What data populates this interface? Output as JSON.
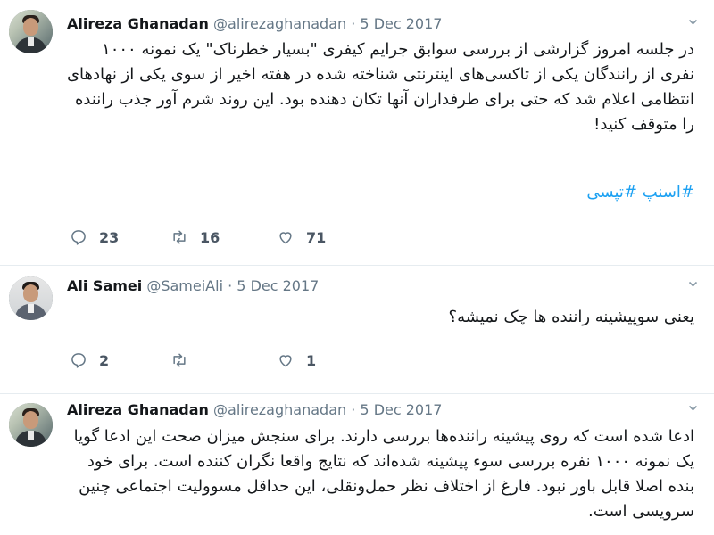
{
  "tweets": [
    {
      "name": "Alireza Ghanadan",
      "handle": "@alirezaghanadan",
      "separator": "·",
      "date": "5 Dec 2017",
      "body": "در جلسه امروز گزارشی از بررسی سوابق جرایم کیفری \"بسیار خطرناک\" یک نمونه ۱۰۰۰ نفری از رانندگان یکی از تاکسی‌های اینترنتی شناخته شده در هفته اخیر از سوی یکی از نهادهای انتظامی اعلام شد که حتی برای طرفداران آنها تکان دهنده بود. این روند شرم آور جذب راننده را متوقف کنید!",
      "hashtags": "#اسنپ #تپسی",
      "replies": "23",
      "retweets": "16",
      "likes": "71"
    },
    {
      "name": "Ali Samei",
      "handle": "@SameiAli",
      "separator": "·",
      "date": "5 Dec 2017",
      "body": "یعنی سوپیشینه راننده ها چک نمیشه؟",
      "replies": "2",
      "retweets": "",
      "likes": "1"
    },
    {
      "name": "Alireza Ghanadan",
      "handle": "@alirezaghanadan",
      "separator": "·",
      "date": "5 Dec 2017",
      "body": "ادعا شده است که روی پیشینه راننده‌ها بررسی دارند. برای سنجش میزان صحت این ادعا گویا یک نمونه ۱۰۰۰ نفره بررسی سوء پیشینه شده‌اند که نتایج واقعا نگران کننده است. برای خود بنده اصلا قابل باور نبود. فارغ از اختلاف نظر حمل‌ونقلی، این حداقل مسوولیت اجتماعی چنین سرویسی است."
    }
  ],
  "icons": {
    "reply": "reply-icon",
    "retweet": "retweet-icon",
    "like": "heart-icon",
    "menu": "chevron-down-icon"
  },
  "colors": {
    "hashtag": "#1da1f2",
    "muted": "#657786",
    "icon": "#657786"
  }
}
